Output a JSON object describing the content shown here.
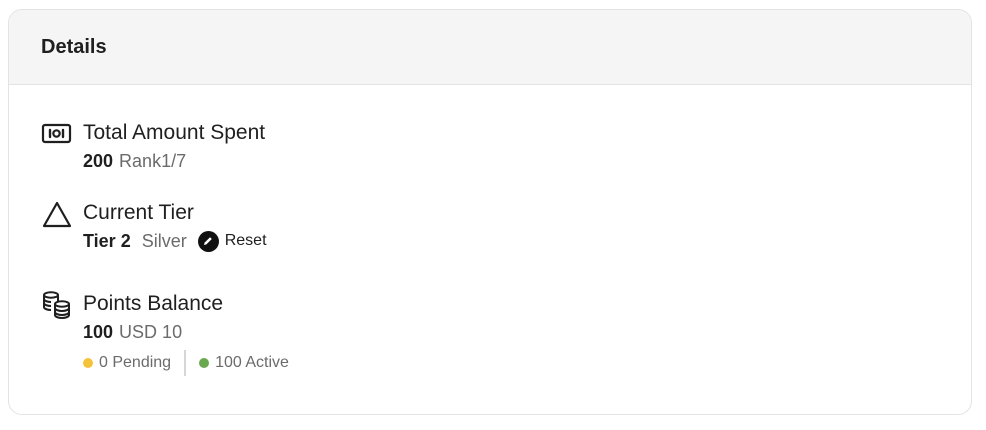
{
  "details": {
    "title": "Details"
  },
  "total_spent": {
    "label": "Total Amount Spent",
    "amount": "200",
    "rank": "Rank1/7",
    "icon": "money-bill-icon"
  },
  "current_tier": {
    "label": "Current Tier",
    "tier": "Tier 2",
    "tier_name": "Silver",
    "reset_label": "Reset",
    "icon": "triangle-icon",
    "reset_icon": "pencil-icon"
  },
  "points_balance": {
    "label": "Points Balance",
    "points": "100",
    "currency_value": "USD 10",
    "pending": "0 Pending",
    "active": "100 Active",
    "icon": "coins-icon",
    "colors": {
      "pending": "#f5c33b",
      "active": "#6aa84f"
    }
  }
}
